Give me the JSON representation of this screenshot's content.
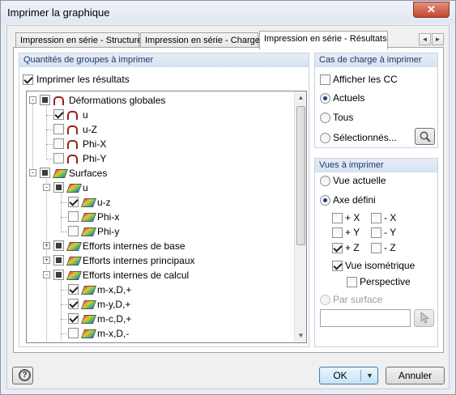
{
  "window": {
    "title": "Imprimer la graphique",
    "close": "✕"
  },
  "tabs": [
    {
      "label": "Impression en série - Structure",
      "active": false
    },
    {
      "label": "Impression en série - Charges",
      "active": false
    },
    {
      "label": "Impression en série - Résultats",
      "active": true
    }
  ],
  "tab_scroll": {
    "left": "◄",
    "right": "►"
  },
  "groups_panel": {
    "header": "Quantités de groupes à imprimer",
    "print_results": {
      "label": "Imprimer les résultats",
      "checked": true
    }
  },
  "tree": [
    {
      "label": "Déformations globales",
      "state": "partial",
      "icon": "deformation-icon",
      "expander": "-"
    },
    {
      "label": "u",
      "state": "checked",
      "icon": "deformation-icon"
    },
    {
      "label": "u-Z",
      "state": "unchecked",
      "icon": "deformation-icon"
    },
    {
      "label": "Phi-X",
      "state": "unchecked",
      "icon": "deformation-icon"
    },
    {
      "label": "Phi-Y",
      "state": "unchecked",
      "icon": "deformation-icon"
    },
    {
      "label": "Surfaces",
      "state": "partial",
      "icon": "surface-icon",
      "expander": "-"
    },
    {
      "label": "u",
      "state": "partial",
      "icon": "surface-icon",
      "expander": "-"
    },
    {
      "label": "u-z",
      "state": "checked",
      "icon": "surface-icon"
    },
    {
      "label": "Phi-x",
      "state": "unchecked",
      "icon": "surface-icon"
    },
    {
      "label": "Phi-y",
      "state": "unchecked",
      "icon": "surface-icon"
    },
    {
      "label": "Efforts internes de base",
      "state": "partial",
      "icon": "surface-icon",
      "expander": "+"
    },
    {
      "label": "Efforts internes principaux",
      "state": "partial",
      "icon": "surface-icon",
      "expander": "+"
    },
    {
      "label": "Efforts internes de calcul",
      "state": "partial",
      "icon": "surface-icon",
      "expander": "-"
    },
    {
      "label": "m-x,D,+",
      "state": "checked",
      "icon": "surface-icon"
    },
    {
      "label": "m-y,D,+",
      "state": "checked",
      "icon": "surface-icon"
    },
    {
      "label": "m-c,D,+",
      "state": "checked",
      "icon": "surface-icon"
    },
    {
      "label": "m-x,D,-",
      "state": "unchecked",
      "icon": "surface-icon"
    }
  ],
  "load_cases": {
    "header": "Cas de charge à imprimer",
    "show_cc": {
      "label": "Afficher les CC",
      "checked": false
    },
    "options": [
      {
        "label": "Actuels",
        "selected": true
      },
      {
        "label": "Tous",
        "selected": false
      },
      {
        "label": "Sélectionnés...",
        "selected": false
      }
    ]
  },
  "views": {
    "header": "Vues à imprimer",
    "current_view": {
      "label": "Vue actuelle",
      "selected": false
    },
    "axis_defined": {
      "label": "Axe défini",
      "selected": true
    },
    "axes": [
      {
        "label": "+ X",
        "checked": false
      },
      {
        "label": "- X",
        "checked": false
      },
      {
        "label": "+ Y",
        "checked": false
      },
      {
        "label": "- Y",
        "checked": false
      },
      {
        "label": "+ Z",
        "checked": true
      },
      {
        "label": "- Z",
        "checked": false
      }
    ],
    "isometric": {
      "label": "Vue isométrique",
      "checked": true
    },
    "perspective": {
      "label": "Perspective",
      "checked": false
    },
    "by_surface": {
      "label": "Par surface",
      "selected": false,
      "disabled": true
    }
  },
  "footer": {
    "help": "?",
    "ok": "OK",
    "cancel": "Annuler"
  }
}
